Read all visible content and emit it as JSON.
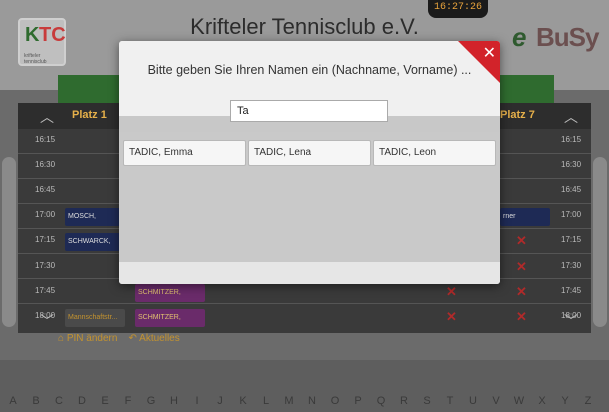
{
  "app": {
    "club_title": "Krifteler Tennisclub e.V.",
    "clock": "16:27:26",
    "logo_k": "K",
    "logo_tc": "TC",
    "logo_sub": "krifteler tennisclub",
    "logo_e": "e",
    "logo_busy": "BuSy"
  },
  "grid": {
    "headers": [
      "Platz 1",
      "Platz 7"
    ],
    "times": [
      "16:15",
      "16:30",
      "16:45",
      "17:00",
      "17:15",
      "17:30",
      "17:45",
      "18:00"
    ],
    "bookings": {
      "mosch": "MOSCH,",
      "schwarck": "SCHWARCK,",
      "schmitzer1": "SCHMITZER,",
      "schmitzer2": "SCHMITZER,",
      "mannschaft": "Mannschaftstr...",
      "partner": "rner"
    }
  },
  "footer": {
    "pin_label": "PIN ändern",
    "aktuelles_label": "Aktuelles"
  },
  "alphabet": [
    "A",
    "B",
    "C",
    "D",
    "E",
    "F",
    "G",
    "H",
    "I",
    "J",
    "K",
    "L",
    "M",
    "N",
    "O",
    "P",
    "Q",
    "R",
    "S",
    "T",
    "U",
    "V",
    "W",
    "X",
    "Y",
    "Z"
  ],
  "modal": {
    "title": "Bitte geben Sie Ihren Namen ein (Nachname, Vorname) ...",
    "search_value": "Ta",
    "results": [
      "TADIC, Emma",
      "TADIC, Lena",
      "TADIC, Leon"
    ],
    "close_icon": "close-icon"
  },
  "colors": {
    "accent_red": "#d2232a",
    "club_green": "#2f6b2f",
    "header_gold": "#e6b04a"
  }
}
